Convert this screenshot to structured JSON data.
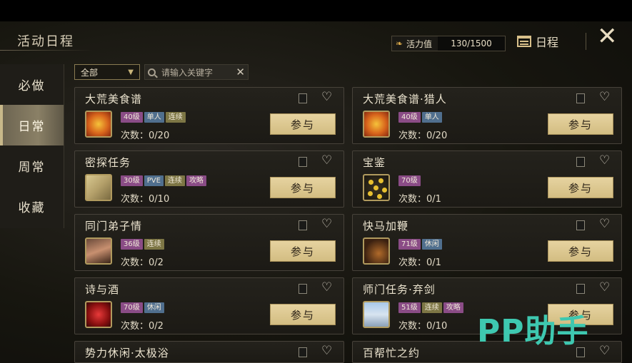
{
  "header": {
    "title": "活动日程",
    "energy_label": "活力值",
    "energy_value": "130/1500",
    "schedule_label": "日程",
    "close_glyph": "✕"
  },
  "sidebar": {
    "items": [
      {
        "label": "必做"
      },
      {
        "label": "日常"
      },
      {
        "label": "周常"
      },
      {
        "label": "收藏"
      }
    ],
    "active_index": 1
  },
  "filter": {
    "selected": "全部"
  },
  "search": {
    "placeholder": "请输入关键字"
  },
  "join_label": "参与",
  "count_prefix": "次数：",
  "cards": [
    {
      "name": "大荒美食谱",
      "tags": [
        "40级",
        "单人",
        "连续"
      ],
      "count": "0/20",
      "icon": "food-icon"
    },
    {
      "name": "大荒美食谱·猎人",
      "tags": [
        "40级",
        "单人"
      ],
      "count": "0/20",
      "icon": "food-icon"
    },
    {
      "name": "密探任务",
      "tags": [
        "30级",
        "PVE",
        "连续",
        "攻略"
      ],
      "count": "0/10",
      "icon": "scroll-icon"
    },
    {
      "name": "宝鉴",
      "tags": [
        "70级"
      ],
      "count": "0/1",
      "icon": "coins-icon"
    },
    {
      "name": "同门弟子情",
      "tags": [
        "36级",
        "连续"
      ],
      "count": "0/2",
      "icon": "portrait-icon"
    },
    {
      "name": "快马加鞭",
      "tags": [
        "71级",
        "休闲"
      ],
      "count": "0/1",
      "icon": "horse-icon"
    },
    {
      "name": "诗与酒",
      "tags": [
        "70级",
        "休闲"
      ],
      "count": "0/2",
      "icon": "wine-icon"
    },
    {
      "name": "师门任务·弃剑",
      "tags": [
        "51级",
        "连续",
        "攻略"
      ],
      "count": "0/10",
      "icon": "tower-icon"
    },
    {
      "name": "势力休闲·太极浴"
    },
    {
      "name": "百帮忙之约"
    }
  ],
  "watermark": "PP助手",
  "colors": {
    "join_button": "#d3bd82",
    "level_tag": "#8a4c86",
    "blue_tag": "#506f8e",
    "olive_tag": "#7d7645",
    "active_tab": "#8a8066"
  }
}
